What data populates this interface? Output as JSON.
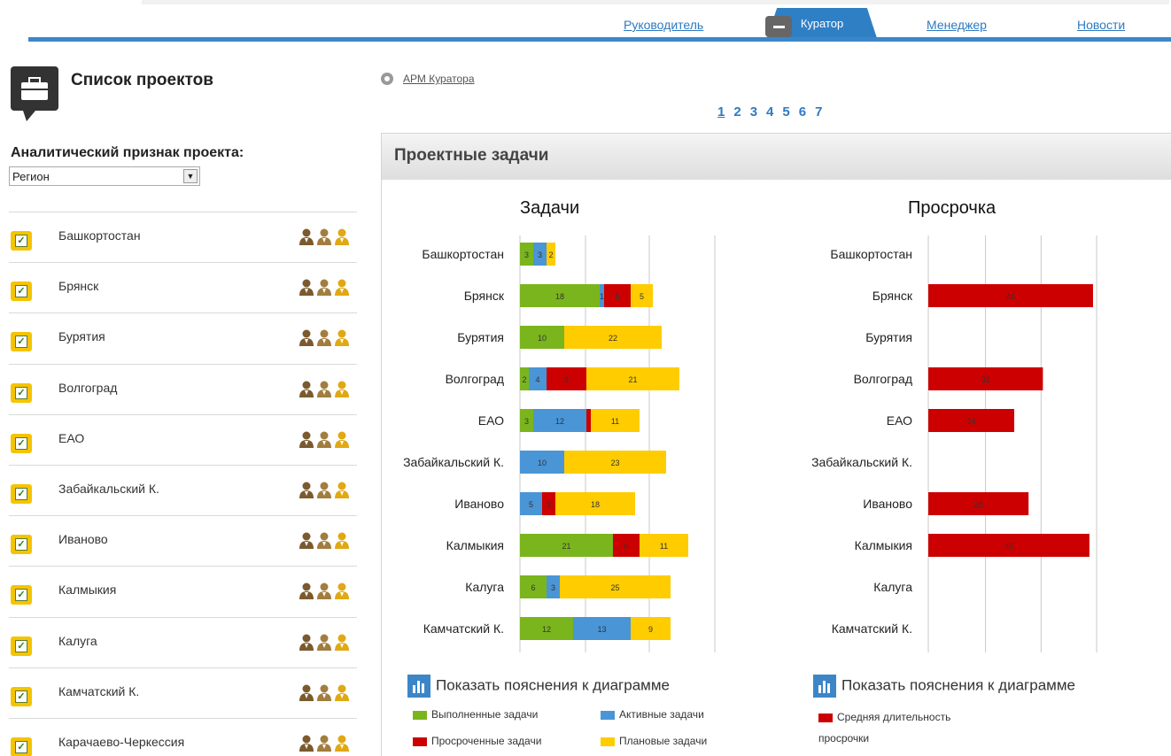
{
  "nav": {
    "tabs": [
      {
        "label": "Руководитель"
      },
      {
        "label": "Куратор",
        "active": true
      },
      {
        "label": "Менеджер"
      },
      {
        "label": "Новости"
      }
    ]
  },
  "sidebar": {
    "title": "Список проектов",
    "attribute_label": "Аналитический признак проекта:",
    "attribute_selected": "Регион",
    "regions": [
      {
        "label": "Башкортостан",
        "checked": true
      },
      {
        "label": "Брянск",
        "checked": true
      },
      {
        "label": "Бурятия",
        "checked": true
      },
      {
        "label": "Волгоград",
        "checked": true
      },
      {
        "label": "ЕАО",
        "checked": true
      },
      {
        "label": "Забайкальский К.",
        "checked": true
      },
      {
        "label": "Иваново",
        "checked": true
      },
      {
        "label": "Калмыкия",
        "checked": true
      },
      {
        "label": "Калуга",
        "checked": true
      },
      {
        "label": "Камчатский К.",
        "checked": true
      },
      {
        "label": "Карачаево-Черкессия",
        "checked": true
      }
    ]
  },
  "breadcrumb": "АРМ Куратора",
  "pager": {
    "pages": [
      "1",
      "2",
      "3",
      "4",
      "5",
      "6",
      "7"
    ],
    "current": "1"
  },
  "panel": {
    "title": "Проектные задачи"
  },
  "legend_toggle_label": "Показать пояснения к диаграмме",
  "colors": {
    "done": "#7ab51d",
    "active": "#4a95d6",
    "overdue": "#cc0000",
    "planned": "#ffcc00",
    "accent": "#2f7fc5"
  },
  "chart_data": [
    {
      "type": "bar",
      "orientation": "horizontal",
      "stacked": true,
      "title": "Задачи",
      "categories": [
        "Башкортостан",
        "Брянск",
        "Бурятия",
        "Волгоград",
        "ЕАО",
        "Забайкальский К.",
        "Иваново",
        "Калмыкия",
        "Калуга",
        "Камчатский К."
      ],
      "series": [
        {
          "name": "Выполненные задачи",
          "color": "#7ab51d",
          "values": [
            3,
            18,
            10,
            2,
            3,
            0,
            0,
            21,
            6,
            12
          ],
          "labels": [
            "3",
            "18",
            "10",
            "2",
            "3",
            "",
            "",
            "21",
            "6",
            "12"
          ]
        },
        {
          "name": "Активные задачи",
          "color": "#4a95d6",
          "values": [
            3,
            1,
            0,
            4,
            12,
            10,
            5,
            0,
            3,
            13
          ],
          "labels": [
            "3",
            "1",
            "",
            "4",
            "12",
            "10",
            "5",
            "",
            "3",
            "13"
          ]
        },
        {
          "name": "Просроченные задачи",
          "color": "#cc0000",
          "values": [
            0,
            6,
            0,
            9,
            1,
            0,
            3,
            6,
            0,
            0
          ],
          "labels": [
            "",
            "6",
            "",
            "9",
            "",
            "",
            "3",
            "6",
            "",
            ""
          ]
        },
        {
          "name": "Плановые задачи",
          "color": "#ffcc00",
          "values": [
            2,
            5,
            22,
            21,
            11,
            23,
            18,
            11,
            25,
            9
          ],
          "labels": [
            "2",
            "5",
            "22",
            "21",
            "11",
            "23",
            "18",
            "11",
            "25",
            "9"
          ]
        }
      ],
      "xlim": [
        0,
        40
      ],
      "grid": true,
      "legend": "bottom"
    },
    {
      "type": "bar",
      "orientation": "horizontal",
      "title": "Просрочка",
      "categories": [
        "Башкортостан",
        "Брянск",
        "Бурятия",
        "Волгоград",
        "ЕАО",
        "Забайкальский К.",
        "Иваново",
        "Калмыкия",
        "Калуга",
        "Камчатский К."
      ],
      "series": [
        {
          "name": "Средняя длительность просрочки",
          "color": "#cc0000",
          "values": [
            0,
            46,
            0,
            32,
            24,
            0,
            28,
            45,
            0,
            0
          ],
          "labels": [
            "",
            "46",
            "",
            "32",
            "24",
            "",
            "28",
            "45",
            "",
            ""
          ]
        }
      ],
      "xlim": [
        0,
        47
      ],
      "grid": true,
      "legend": "bottom"
    }
  ]
}
